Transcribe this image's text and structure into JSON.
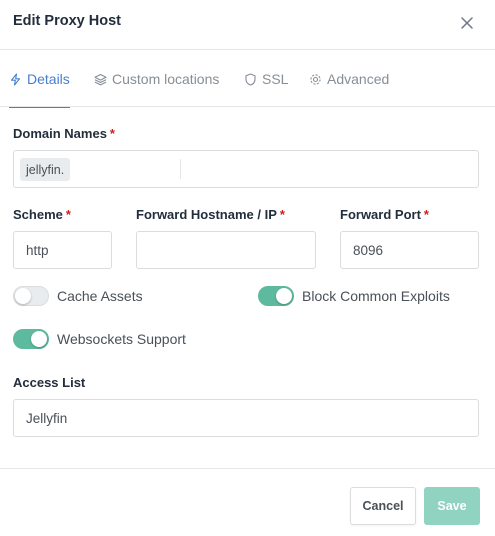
{
  "modal": {
    "title": "Edit Proxy Host"
  },
  "tabs": [
    {
      "label": "Details",
      "icon": "lightning-icon",
      "active": true
    },
    {
      "label": "Custom locations",
      "icon": "layers-icon",
      "active": false
    },
    {
      "label": "SSL",
      "icon": "shield-icon",
      "active": false
    },
    {
      "label": "Advanced",
      "icon": "gear-icon",
      "active": false
    }
  ],
  "form": {
    "domain_names": {
      "label": "Domain Names",
      "required_mark": "*",
      "chips": [
        "jellyfin."
      ]
    },
    "scheme": {
      "label": "Scheme",
      "required_mark": "*",
      "value": "http"
    },
    "forward_hostname": {
      "label": "Forward Hostname / IP",
      "required_mark": "*",
      "value": ""
    },
    "forward_port": {
      "label": "Forward Port",
      "required_mark": "*",
      "value": "8096"
    },
    "cache_assets": {
      "label": "Cache Assets",
      "enabled": false
    },
    "block_exploits": {
      "label": "Block Common Exploits",
      "enabled": true
    },
    "websockets": {
      "label": "Websockets Support",
      "enabled": true
    },
    "access_list": {
      "label": "Access List",
      "value": "Jellyfin"
    }
  },
  "footer": {
    "cancel_label": "Cancel",
    "save_label": "Save"
  },
  "colors": {
    "accent": "#467fcf",
    "toggle_on": "#5eba9f",
    "save_button": "#8fd3c0",
    "required": "#cd201f"
  }
}
